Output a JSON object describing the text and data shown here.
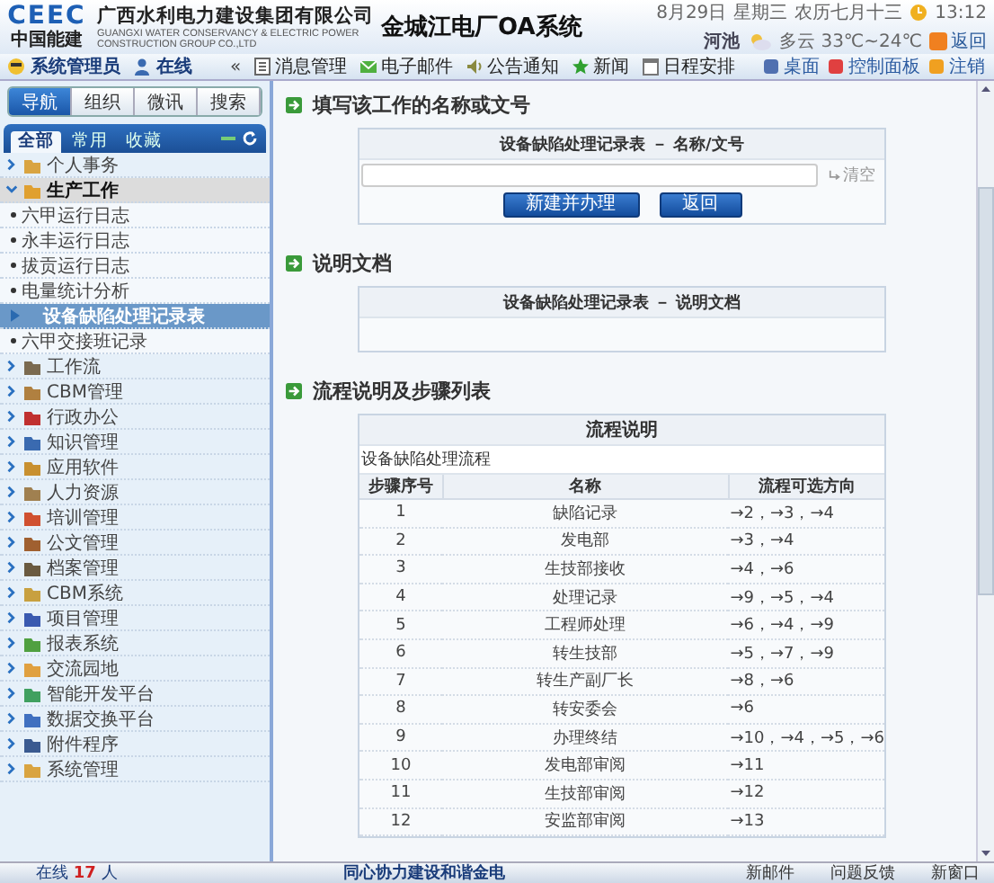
{
  "header": {
    "logo": "CEEC",
    "logo_sub": "中国能建",
    "company": "广西水利电力建设集团有限公司",
    "company_en": "GUANGXI WATER CONSERVANCY & ELECTRIC POWER CONSTRUCTION GROUP CO.,LTD",
    "system_title": "金城江电厂OA系统",
    "date": "8月29日",
    "weekday": "星期三",
    "lunar": "农历七月十三",
    "time": "13:12",
    "city": "河池",
    "weather": "多云 33℃~24℃",
    "exit": "返回"
  },
  "toolbar": {
    "user": "系统管理员",
    "status": "在线",
    "collapse": "«",
    "items": [
      {
        "label": "消息管理"
      },
      {
        "label": "电子邮件"
      },
      {
        "label": "公告通知"
      },
      {
        "label": "新闻"
      },
      {
        "label": "日程安排"
      }
    ],
    "right": [
      {
        "label": "桌面"
      },
      {
        "label": "控制面板"
      },
      {
        "label": "注销"
      }
    ]
  },
  "sidebar": {
    "tabs": [
      {
        "label": "导航",
        "selected": true
      },
      {
        "label": "组织",
        "selected": false
      },
      {
        "label": "微讯",
        "selected": false
      },
      {
        "label": "搜索",
        "selected": false
      }
    ],
    "subtabs": [
      {
        "label": "全部",
        "selected": true
      },
      {
        "label": "常用",
        "selected": false
      },
      {
        "label": "收藏",
        "selected": false
      }
    ],
    "groups": [
      {
        "label": "个人事务",
        "expanded": false
      },
      {
        "label": "生产工作",
        "expanded": true,
        "children": [
          {
            "label": "六甲运行日志",
            "selected": false
          },
          {
            "label": "永丰运行日志",
            "selected": false
          },
          {
            "label": "拔贡运行日志",
            "selected": false
          },
          {
            "label": "电量统计分析",
            "selected": false
          },
          {
            "label": "设备缺陷处理记录表",
            "selected": true
          },
          {
            "label": "六甲交接班记录",
            "selected": false
          }
        ]
      },
      {
        "label": "工作流",
        "expanded": false
      },
      {
        "label": "CBM管理",
        "expanded": false
      },
      {
        "label": "行政办公",
        "expanded": false
      },
      {
        "label": "知识管理",
        "expanded": false
      },
      {
        "label": "应用软件",
        "expanded": false
      },
      {
        "label": "人力资源",
        "expanded": false
      },
      {
        "label": "培训管理",
        "expanded": false
      },
      {
        "label": "公文管理",
        "expanded": false
      },
      {
        "label": "档案管理",
        "expanded": false
      },
      {
        "label": "CBM系统",
        "expanded": false
      },
      {
        "label": "项目管理",
        "expanded": false
      },
      {
        "label": "报表系统",
        "expanded": false
      },
      {
        "label": "交流园地",
        "expanded": false
      },
      {
        "label": "智能开发平台",
        "expanded": false
      },
      {
        "label": "数据交换平台",
        "expanded": false
      },
      {
        "label": "附件程序",
        "expanded": false
      },
      {
        "label": "系统管理",
        "expanded": false
      }
    ]
  },
  "main": {
    "name_section": {
      "title": "填写该工作的名称或文号",
      "box_title": "设备缺陷处理记录表 － 名称/文号",
      "clear": "清空",
      "buttons": [
        "新建并办理",
        "返回"
      ]
    },
    "doc_section": {
      "title": "说明文档",
      "box_title": "设备缺陷处理记录表 － 说明文档"
    },
    "flow_section": {
      "title": "流程说明及步骤列表",
      "caption": "流程说明",
      "description": "设备缺陷处理流程",
      "columns": [
        "步骤序号",
        "名称",
        "流程可选方向"
      ],
      "rows": [
        [
          "1",
          "缺陷记录",
          "→2，→3，→4"
        ],
        [
          "2",
          "发电部",
          "→3，→4"
        ],
        [
          "3",
          "生技部接收",
          "→4，→6"
        ],
        [
          "4",
          "处理记录",
          "→9，→5，→4"
        ],
        [
          "5",
          "工程师处理",
          "→6，→4，→9"
        ],
        [
          "6",
          "转生技部",
          "→5，→7，→9"
        ],
        [
          "7",
          "转生产副厂长",
          "→8，→6"
        ],
        [
          "8",
          "转安委会",
          "→6"
        ],
        [
          "9",
          "办理终结",
          "→10，→4，→5，→6"
        ],
        [
          "10",
          "发电部审阅",
          "→11"
        ],
        [
          "11",
          "生技部审阅",
          "→12"
        ],
        [
          "12",
          "安监部审阅",
          "→13"
        ]
      ]
    }
  },
  "status_bar": {
    "online_label": "在线",
    "online_count": "17",
    "online_unit": "人",
    "slogan": "同心协力建设和谐金电",
    "links": [
      "新邮件",
      "问题反馈",
      "新窗口"
    ]
  }
}
